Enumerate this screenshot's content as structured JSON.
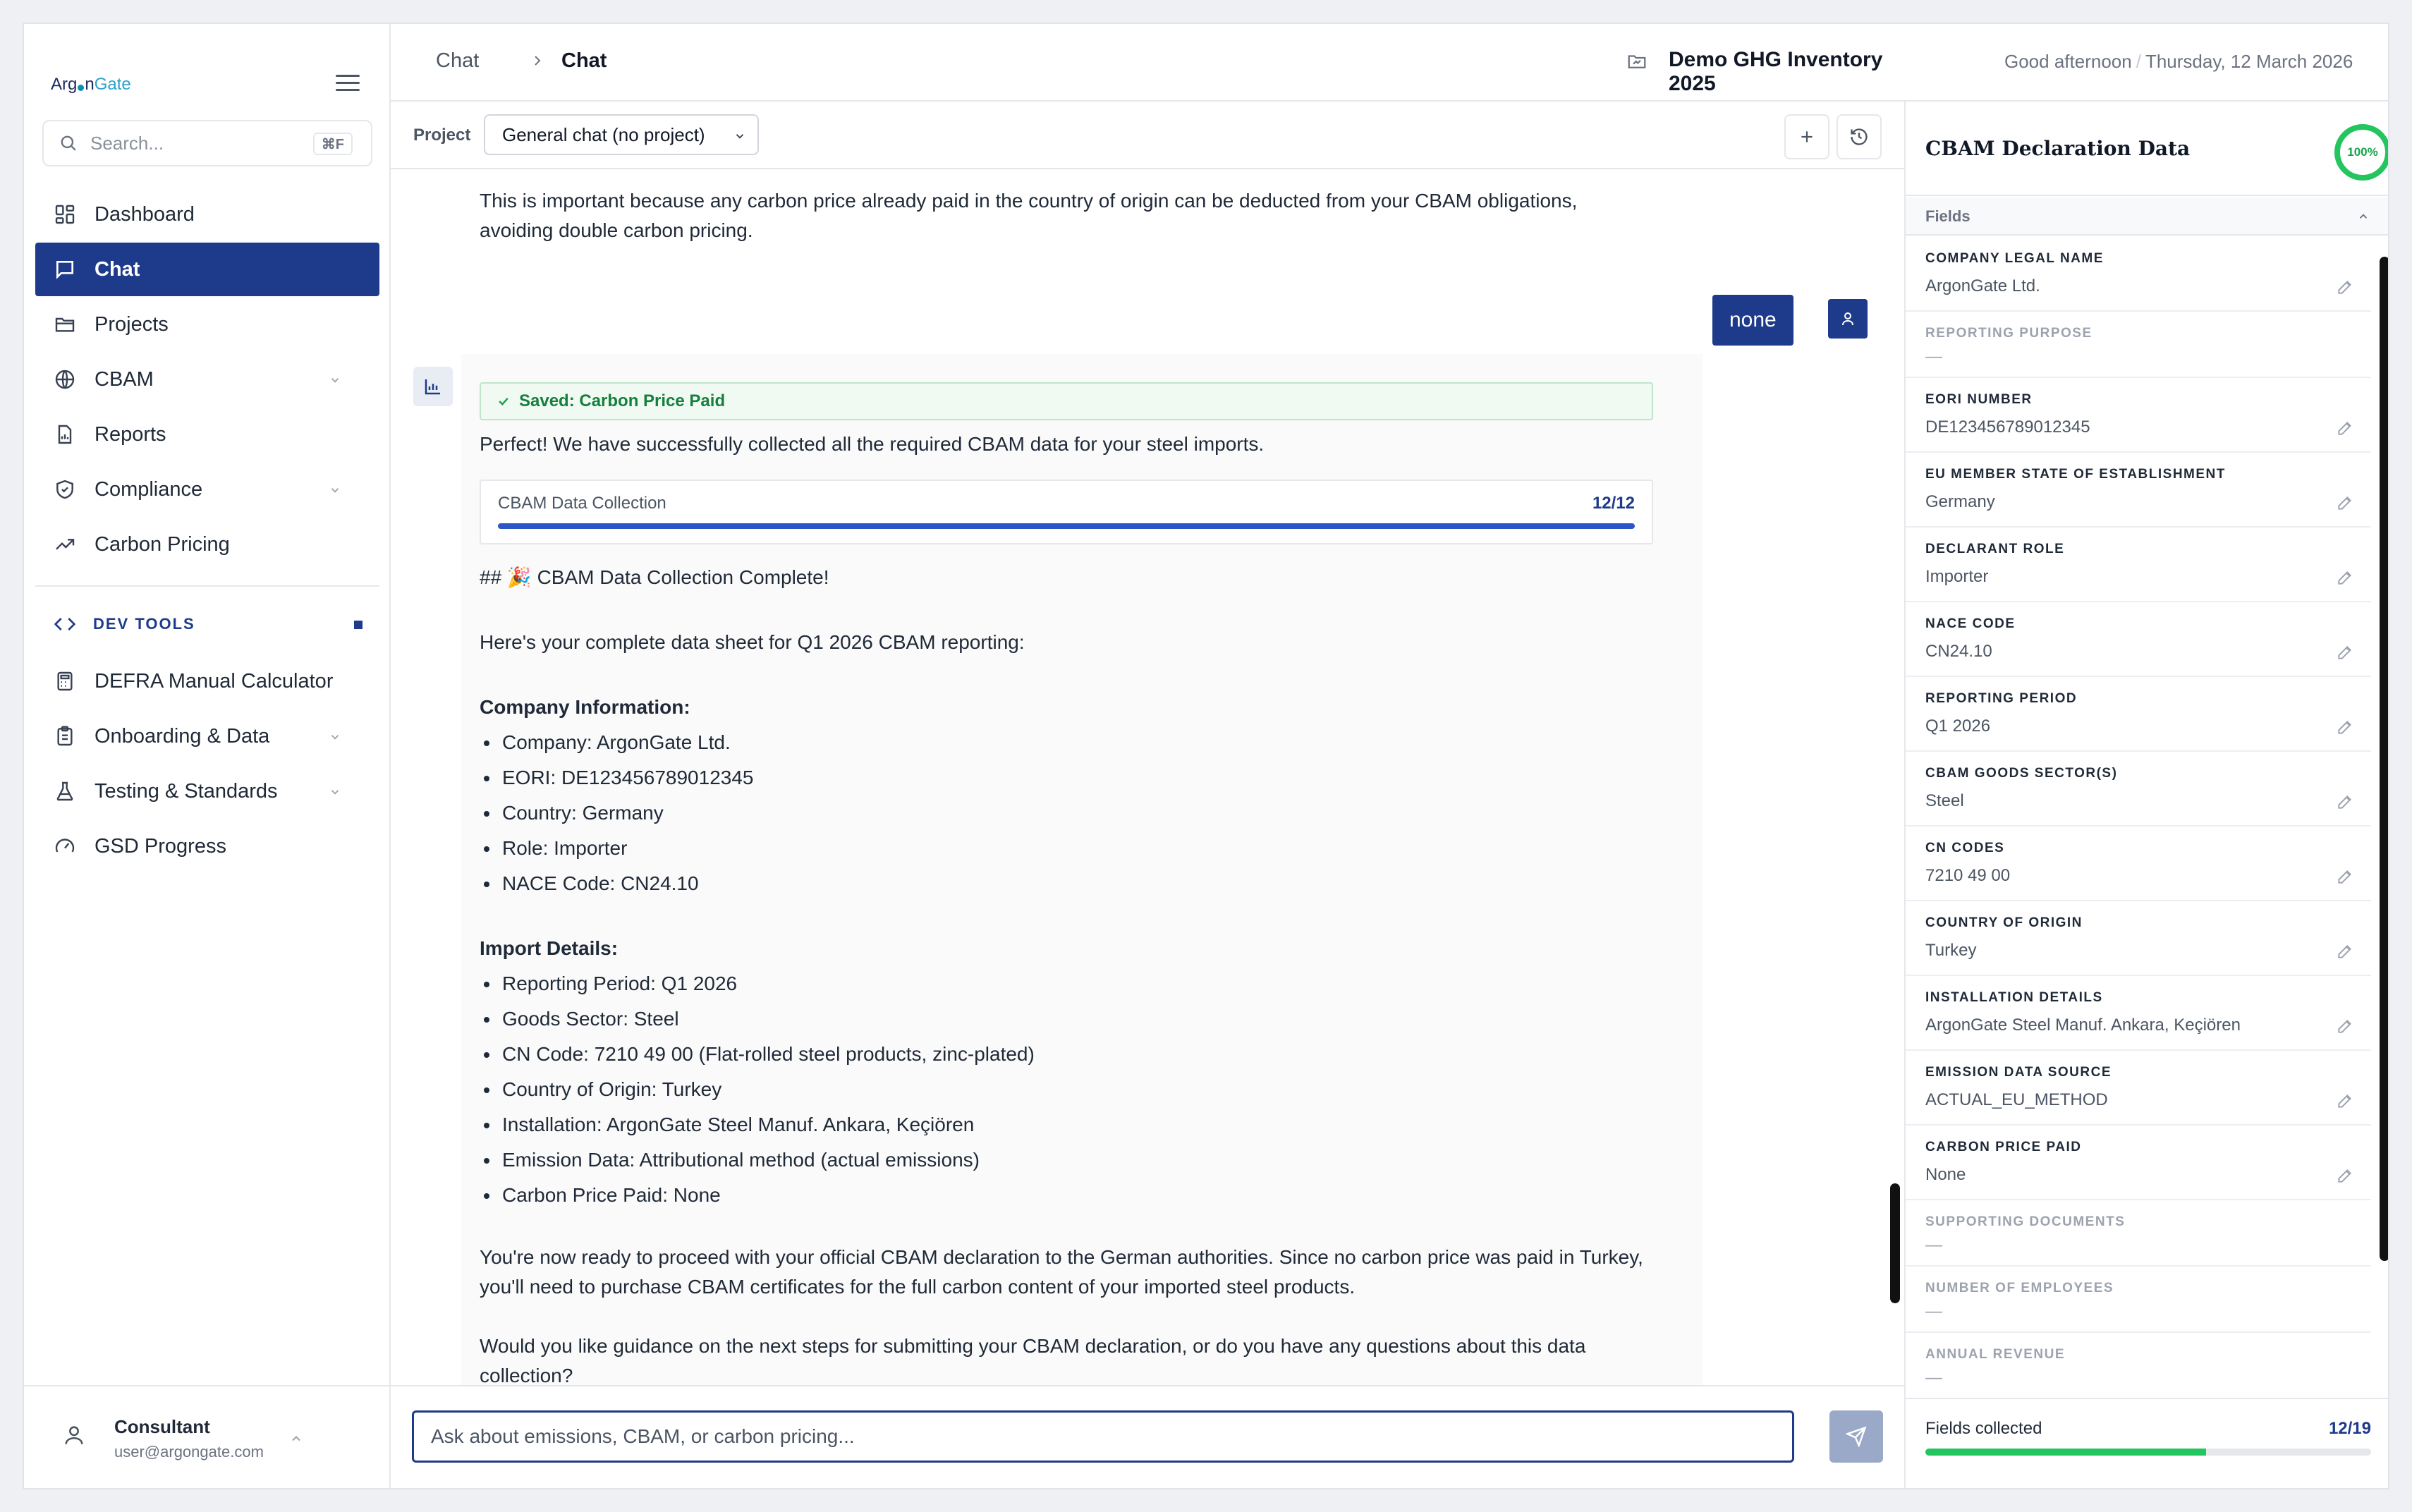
{
  "brand": {
    "logo_part1": "Arg",
    "logo_part2": "n",
    "logo_part3": "Gate"
  },
  "sidebar": {
    "search_placeholder": "Search...",
    "search_shortcut": "⌘F",
    "items": [
      {
        "label": "Dashboard",
        "icon": "dashboard-icon"
      },
      {
        "label": "Chat",
        "icon": "chat-icon",
        "active": true
      },
      {
        "label": "Projects",
        "icon": "folder-icon"
      },
      {
        "label": "CBAM",
        "icon": "globe-icon",
        "expandable": true
      },
      {
        "label": "Reports",
        "icon": "report-icon"
      },
      {
        "label": "Compliance",
        "icon": "shield-icon",
        "expandable": true
      },
      {
        "label": "Carbon Pricing",
        "icon": "trending-icon"
      }
    ],
    "devtools_label": "DEV TOOLS",
    "dev_items": [
      {
        "label": "DEFRA Manual Calculator",
        "icon": "calculator-icon"
      },
      {
        "label": "Onboarding & Data",
        "icon": "clipboard-icon",
        "expandable": true
      },
      {
        "label": "Testing & Standards",
        "icon": "flask-icon",
        "expandable": true
      },
      {
        "label": "GSD Progress",
        "icon": "gauge-icon"
      }
    ],
    "user": {
      "name": "Consultant",
      "email": "user@argongate.com"
    }
  },
  "header": {
    "breadcrumb": [
      "Chat",
      "Chat"
    ],
    "project_name": "Demo GHG Inventory 2025",
    "greeting": "Good afternoon",
    "date": "Thursday, 12 March 2026"
  },
  "project_bar": {
    "label": "Project",
    "selected": "General chat (no project)"
  },
  "chat": {
    "top_text": "This is important because any carbon price already paid in the country of origin can be deducted from your CBAM obligations, avoiding double carbon pricing.",
    "user_message": "none",
    "saved_badge": "Saved: Carbon Price Paid",
    "perfect_line": "Perfect! We have successfully collected all the required CBAM data for your steel imports.",
    "progress": {
      "title": "CBAM Data Collection",
      "count": "12/12",
      "value": 1.0
    },
    "heading": "## 🎉 CBAM Data Collection Complete!",
    "intro": "Here's your complete data sheet for Q1 2026 CBAM reporting:",
    "company_heading": "Company Information:",
    "company_items": [
      "Company: ArgonGate Ltd.",
      "EORI: DE123456789012345",
      "Country: Germany",
      "Role: Importer",
      "NACE Code: CN24.10"
    ],
    "import_heading": "Import Details:",
    "import_items": [
      "Reporting Period: Q1 2026",
      "Goods Sector: Steel",
      "CN Code: 7210 49 00 (Flat-rolled steel products, zinc-plated)",
      "Country of Origin: Turkey",
      "Installation: ArgonGate Steel Manuf. Ankara, Keçiören",
      "Emission Data: Attributional method (actual emissions)",
      "Carbon Price Paid: None"
    ],
    "closing1": "You're now ready to proceed with your official CBAM declaration to the German authorities. Since no carbon price was paid in Turkey, you'll need to purchase CBAM certificates for the full carbon content of your imported steel products.",
    "closing2": "Would you like guidance on the next steps for submitting your CBAM declaration, or do you have any questions about this data collection?",
    "input_placeholder": "Ask about emissions, CBAM, or carbon pricing..."
  },
  "panel": {
    "title": "CBAM Declaration Data",
    "completion": "100%",
    "fields_label": "Fields",
    "fields": [
      {
        "key": "COMPANY LEGAL NAME",
        "value": "ArgonGate Ltd.",
        "filled": true
      },
      {
        "key": "REPORTING PURPOSE",
        "value": "—",
        "filled": false
      },
      {
        "key": "EORI NUMBER",
        "value": "DE123456789012345",
        "filled": true
      },
      {
        "key": "EU MEMBER STATE OF ESTABLISHMENT",
        "value": "Germany",
        "filled": true
      },
      {
        "key": "DECLARANT ROLE",
        "value": "Importer",
        "filled": true
      },
      {
        "key": "NACE CODE",
        "value": "CN24.10",
        "filled": true
      },
      {
        "key": "REPORTING PERIOD",
        "value": "Q1 2026",
        "filled": true
      },
      {
        "key": "CBAM GOODS SECTOR(S)",
        "value": "Steel",
        "filled": true
      },
      {
        "key": "CN CODES",
        "value": "7210 49 00",
        "filled": true
      },
      {
        "key": "COUNTRY OF ORIGIN",
        "value": "Turkey",
        "filled": true
      },
      {
        "key": "INSTALLATION DETAILS",
        "value": "ArgonGate Steel Manuf. Ankara, Keçiören",
        "filled": true
      },
      {
        "key": "EMISSION DATA SOURCE",
        "value": "ACTUAL_EU_METHOD",
        "filled": true
      },
      {
        "key": "CARBON PRICE PAID",
        "value": "None",
        "filled": true
      },
      {
        "key": "SUPPORTING DOCUMENTS",
        "value": "—",
        "filled": false
      },
      {
        "key": "NUMBER OF EMPLOYEES",
        "value": "—",
        "filled": false
      },
      {
        "key": "ANNUAL REVENUE",
        "value": "—",
        "filled": false
      }
    ],
    "footer_label": "Fields collected",
    "footer_count": "12/19",
    "footer_value": 0.63
  },
  "colors": {
    "brand_navy": "#1e3a8a",
    "success_green": "#22c55e",
    "accent_blue": "#2b56c8"
  }
}
